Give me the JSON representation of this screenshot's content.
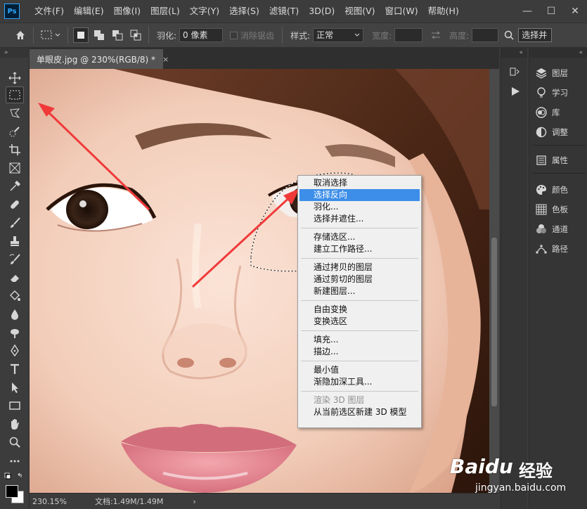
{
  "app": {
    "logo": "Ps",
    "menu": [
      "文件(F)",
      "编辑(E)",
      "图像(I)",
      "图层(L)",
      "文字(Y)",
      "选择(S)",
      "滤镜(T)",
      "3D(D)",
      "视图(V)",
      "窗口(W)",
      "帮助(H)"
    ],
    "window_controls": {
      "minimize": "—",
      "maximize": "☐",
      "close": "✕"
    }
  },
  "options": {
    "feather_label": "羽化:",
    "feather_value": "0 像素",
    "antialias_label": "消除锯齿",
    "style_label": "样式:",
    "style_value": "正常",
    "width_label": "宽度:",
    "height_label": "高度:",
    "select_mask_button": "选择并"
  },
  "document": {
    "tab_title": "单眼皮.jpg @ 230%(RGB/8) *",
    "tab_close": "×"
  },
  "status": {
    "zoom": "230.15%",
    "doc_info": "文档:1.49M/1.49M",
    "arrow": "›"
  },
  "panels": {
    "group1": [
      "图层",
      "学习",
      "库",
      "调整"
    ],
    "group2": [
      "属性"
    ],
    "group3": [
      "颜色",
      "色板",
      "通道",
      "路径"
    ]
  },
  "context_menu": {
    "groups": [
      [
        {
          "label": "取消选择"
        },
        {
          "label": "选择反向",
          "highlighted": true
        },
        {
          "label": "羽化..."
        },
        {
          "label": "选择并遮住..."
        }
      ],
      [
        {
          "label": "存储选区..."
        },
        {
          "label": "建立工作路径..."
        }
      ],
      [
        {
          "label": "通过拷贝的图层"
        },
        {
          "label": "通过剪切的图层"
        },
        {
          "label": "新建图层..."
        }
      ],
      [
        {
          "label": "自由变换"
        },
        {
          "label": "变换选区"
        }
      ],
      [
        {
          "label": "填充..."
        },
        {
          "label": "描边..."
        }
      ],
      [
        {
          "label": "最小值"
        },
        {
          "label": "渐隐加深工具..."
        }
      ],
      [
        {
          "label": "渲染 3D 图层",
          "disabled": true
        },
        {
          "label": "从当前选区新建 3D 模型"
        }
      ]
    ]
  },
  "watermark": {
    "brand": "Baidu",
    "brand_suffix": "经验",
    "url": "jingyan.baidu.com"
  },
  "colors": {
    "accent_highlight": "#3c8ee8",
    "arrow_red": "#f03a3a"
  },
  "icons": {
    "tools": [
      "move-icon",
      "marquee-icon",
      "lasso-icon",
      "quick-select-icon",
      "crop-icon",
      "frame-icon",
      "eyedropper-icon",
      "healing-icon",
      "brush-icon",
      "stamp-icon",
      "history-brush-icon",
      "eraser-icon",
      "bucket-icon",
      "blur-icon",
      "dodge-icon",
      "pen-icon",
      "type-icon",
      "path-select-icon",
      "rectangle-icon",
      "hand-icon",
      "zoom-icon",
      "more-icon"
    ]
  }
}
